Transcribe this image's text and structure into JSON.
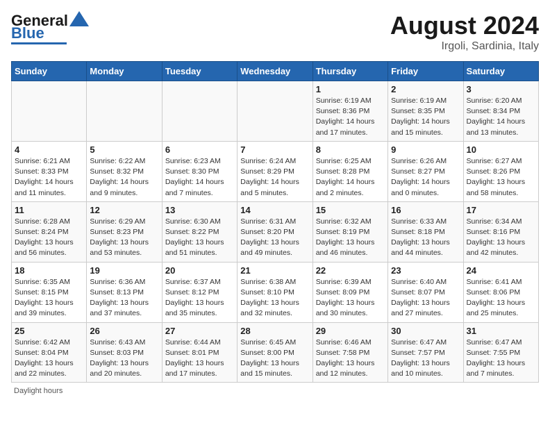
{
  "header": {
    "logo_general": "General",
    "logo_blue": "Blue",
    "month_year": "August 2024",
    "location": "Irgoli, Sardinia, Italy"
  },
  "days_of_week": [
    "Sunday",
    "Monday",
    "Tuesday",
    "Wednesday",
    "Thursday",
    "Friday",
    "Saturday"
  ],
  "weeks": [
    [
      {
        "day": "",
        "info": ""
      },
      {
        "day": "",
        "info": ""
      },
      {
        "day": "",
        "info": ""
      },
      {
        "day": "",
        "info": ""
      },
      {
        "day": "1",
        "info": "Sunrise: 6:19 AM\nSunset: 8:36 PM\nDaylight: 14 hours and 17 minutes."
      },
      {
        "day": "2",
        "info": "Sunrise: 6:19 AM\nSunset: 8:35 PM\nDaylight: 14 hours and 15 minutes."
      },
      {
        "day": "3",
        "info": "Sunrise: 6:20 AM\nSunset: 8:34 PM\nDaylight: 14 hours and 13 minutes."
      }
    ],
    [
      {
        "day": "4",
        "info": "Sunrise: 6:21 AM\nSunset: 8:33 PM\nDaylight: 14 hours and 11 minutes."
      },
      {
        "day": "5",
        "info": "Sunrise: 6:22 AM\nSunset: 8:32 PM\nDaylight: 14 hours and 9 minutes."
      },
      {
        "day": "6",
        "info": "Sunrise: 6:23 AM\nSunset: 8:30 PM\nDaylight: 14 hours and 7 minutes."
      },
      {
        "day": "7",
        "info": "Sunrise: 6:24 AM\nSunset: 8:29 PM\nDaylight: 14 hours and 5 minutes."
      },
      {
        "day": "8",
        "info": "Sunrise: 6:25 AM\nSunset: 8:28 PM\nDaylight: 14 hours and 2 minutes."
      },
      {
        "day": "9",
        "info": "Sunrise: 6:26 AM\nSunset: 8:27 PM\nDaylight: 14 hours and 0 minutes."
      },
      {
        "day": "10",
        "info": "Sunrise: 6:27 AM\nSunset: 8:26 PM\nDaylight: 13 hours and 58 minutes."
      }
    ],
    [
      {
        "day": "11",
        "info": "Sunrise: 6:28 AM\nSunset: 8:24 PM\nDaylight: 13 hours and 56 minutes."
      },
      {
        "day": "12",
        "info": "Sunrise: 6:29 AM\nSunset: 8:23 PM\nDaylight: 13 hours and 53 minutes."
      },
      {
        "day": "13",
        "info": "Sunrise: 6:30 AM\nSunset: 8:22 PM\nDaylight: 13 hours and 51 minutes."
      },
      {
        "day": "14",
        "info": "Sunrise: 6:31 AM\nSunset: 8:20 PM\nDaylight: 13 hours and 49 minutes."
      },
      {
        "day": "15",
        "info": "Sunrise: 6:32 AM\nSunset: 8:19 PM\nDaylight: 13 hours and 46 minutes."
      },
      {
        "day": "16",
        "info": "Sunrise: 6:33 AM\nSunset: 8:18 PM\nDaylight: 13 hours and 44 minutes."
      },
      {
        "day": "17",
        "info": "Sunrise: 6:34 AM\nSunset: 8:16 PM\nDaylight: 13 hours and 42 minutes."
      }
    ],
    [
      {
        "day": "18",
        "info": "Sunrise: 6:35 AM\nSunset: 8:15 PM\nDaylight: 13 hours and 39 minutes."
      },
      {
        "day": "19",
        "info": "Sunrise: 6:36 AM\nSunset: 8:13 PM\nDaylight: 13 hours and 37 minutes."
      },
      {
        "day": "20",
        "info": "Sunrise: 6:37 AM\nSunset: 8:12 PM\nDaylight: 13 hours and 35 minutes."
      },
      {
        "day": "21",
        "info": "Sunrise: 6:38 AM\nSunset: 8:10 PM\nDaylight: 13 hours and 32 minutes."
      },
      {
        "day": "22",
        "info": "Sunrise: 6:39 AM\nSunset: 8:09 PM\nDaylight: 13 hours and 30 minutes."
      },
      {
        "day": "23",
        "info": "Sunrise: 6:40 AM\nSunset: 8:07 PM\nDaylight: 13 hours and 27 minutes."
      },
      {
        "day": "24",
        "info": "Sunrise: 6:41 AM\nSunset: 8:06 PM\nDaylight: 13 hours and 25 minutes."
      }
    ],
    [
      {
        "day": "25",
        "info": "Sunrise: 6:42 AM\nSunset: 8:04 PM\nDaylight: 13 hours and 22 minutes."
      },
      {
        "day": "26",
        "info": "Sunrise: 6:43 AM\nSunset: 8:03 PM\nDaylight: 13 hours and 20 minutes."
      },
      {
        "day": "27",
        "info": "Sunrise: 6:44 AM\nSunset: 8:01 PM\nDaylight: 13 hours and 17 minutes."
      },
      {
        "day": "28",
        "info": "Sunrise: 6:45 AM\nSunset: 8:00 PM\nDaylight: 13 hours and 15 minutes."
      },
      {
        "day": "29",
        "info": "Sunrise: 6:46 AM\nSunset: 7:58 PM\nDaylight: 13 hours and 12 minutes."
      },
      {
        "day": "30",
        "info": "Sunrise: 6:47 AM\nSunset: 7:57 PM\nDaylight: 13 hours and 10 minutes."
      },
      {
        "day": "31",
        "info": "Sunrise: 6:47 AM\nSunset: 7:55 PM\nDaylight: 13 hours and 7 minutes."
      }
    ]
  ],
  "footer": {
    "daylight_label": "Daylight hours"
  }
}
